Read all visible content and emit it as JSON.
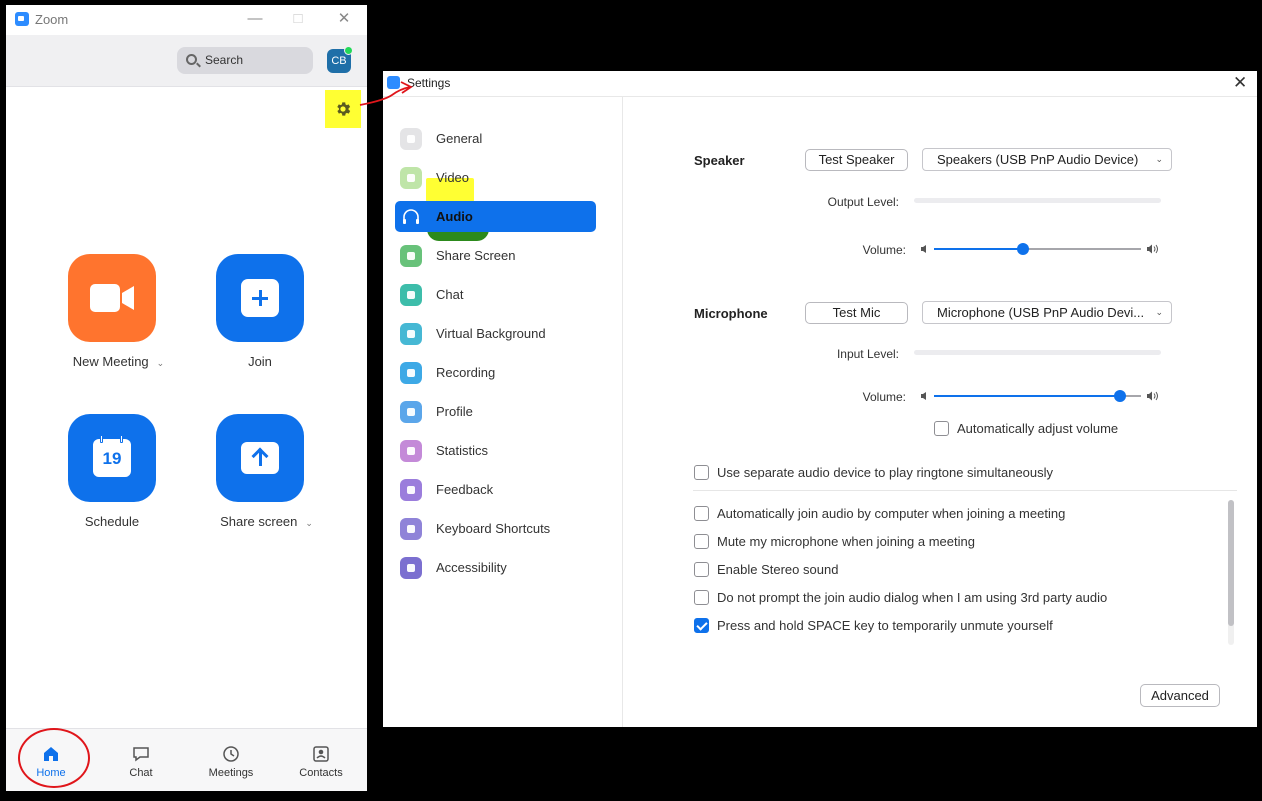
{
  "zoom": {
    "title": "Zoom",
    "search_label": "Search",
    "avatar_initials": "CB",
    "actions": {
      "new_meeting": "New Meeting",
      "join": "Join",
      "schedule": "Schedule",
      "schedule_day": "19",
      "share_screen": "Share screen"
    },
    "nav": {
      "home": "Home",
      "chat": "Chat",
      "meetings": "Meetings",
      "contacts": "Contacts"
    },
    "colors": {
      "orange": "#ff742e",
      "blue": "#0e71eb",
      "active_nav": "#0e71eb"
    }
  },
  "settings": {
    "title": "Settings",
    "sidebar": [
      {
        "label": "General",
        "icon": "gear-icon",
        "color": "#e4e4e6"
      },
      {
        "label": "Video",
        "icon": "video-camera-icon",
        "color": "#bfe5a8"
      },
      {
        "label": "Audio",
        "icon": "headphones-icon",
        "color": "#0e71eb"
      },
      {
        "label": "Share Screen",
        "icon": "share-screen-icon",
        "color": "#68c27a"
      },
      {
        "label": "Chat",
        "icon": "chat-bubble-icon",
        "color": "#3dbdaa"
      },
      {
        "label": "Virtual Background",
        "icon": "virtual-background-icon",
        "color": "#46b8d4"
      },
      {
        "label": "Recording",
        "icon": "recording-icon",
        "color": "#3da9e6"
      },
      {
        "label": "Profile",
        "icon": "profile-icon",
        "color": "#5ba6ea"
      },
      {
        "label": "Statistics",
        "icon": "statistics-icon",
        "color": "#c48ad8"
      },
      {
        "label": "Feedback",
        "icon": "feedback-icon",
        "color": "#9b7ddc"
      },
      {
        "label": "Keyboard Shortcuts",
        "icon": "keyboard-icon",
        "color": "#8f83d8"
      },
      {
        "label": "Accessibility",
        "icon": "accessibility-icon",
        "color": "#7b6fd0"
      }
    ],
    "speaker": {
      "title": "Speaker",
      "test_button": "Test Speaker",
      "device": "Speakers (USB PnP Audio Device)",
      "output_level_label": "Output Level:",
      "volume_label": "Volume:",
      "volume": 0.43
    },
    "microphone": {
      "title": "Microphone",
      "test_button": "Test Mic",
      "device": "Microphone (USB PnP Audio Devi...",
      "input_level_label": "Input Level:",
      "volume_label": "Volume:",
      "volume": 0.9,
      "auto_adjust": "Automatically adjust volume"
    },
    "options": [
      {
        "label": "Use separate audio device to play ringtone simultaneously",
        "checked": false
      },
      {
        "label": "Automatically join audio by computer when joining a meeting",
        "checked": false
      },
      {
        "label": "Mute my microphone when joining a meeting",
        "checked": false
      },
      {
        "label": "Enable Stereo sound",
        "checked": false
      },
      {
        "label": "Do not prompt the join audio dialog when I am using 3rd party audio",
        "checked": false
      },
      {
        "label": "Press and hold SPACE key to temporarily unmute yourself",
        "checked": true
      }
    ],
    "advanced_button": "Advanced"
  },
  "annotations": {
    "highlight_yellow": "#ffff33",
    "highlight_green": "#2c8a1c",
    "ink_red": "#e0161b"
  }
}
